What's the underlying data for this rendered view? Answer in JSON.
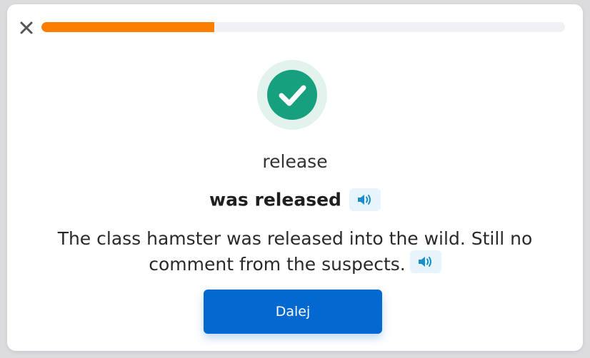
{
  "progress": {
    "fraction": 0.33,
    "color": "#fa7f00",
    "track_color": "#f1f0f4"
  },
  "close": {
    "icon": "close-icon"
  },
  "result": {
    "icon": "checkmark-icon",
    "color": "#17a07e"
  },
  "prompt_word": "release",
  "answer": "was released",
  "sentence": "The class hamster was released into the wild. Still no comment from the suspects.",
  "audio_icon": "speaker-icon",
  "next_button": {
    "label": "Dalej",
    "color": "#0368cf"
  }
}
